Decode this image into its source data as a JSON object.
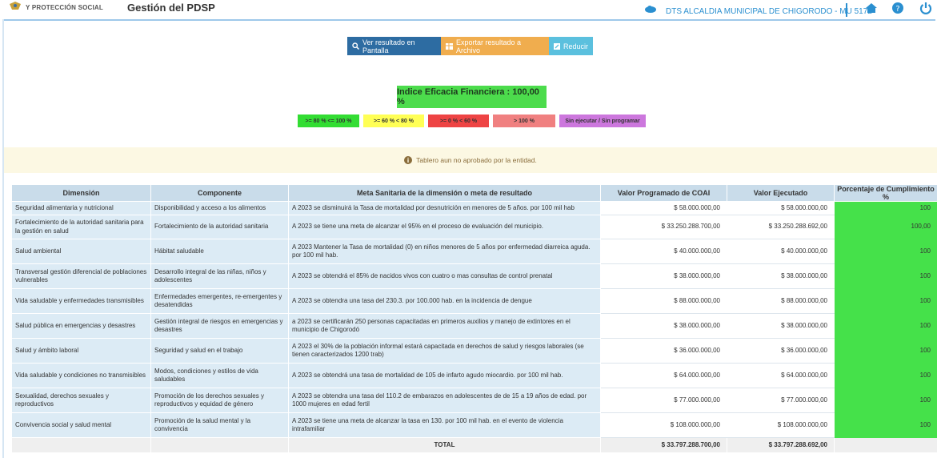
{
  "header": {
    "org_label": "Y PROTECCIÓN SOCIAL",
    "app_title": "Gestión del PDSP",
    "entity": "DTS ALCALDIA MUNICIPAL DE CHIGORODO - MU 5172",
    "icons": [
      "home-icon",
      "help-icon",
      "power-icon"
    ],
    "accent_color": "#2a8fd0"
  },
  "actions": {
    "view_label": "Ver resultado en Pantalla",
    "export_label": "Exportar resultado a Archivo",
    "reduce_label": "Reducir"
  },
  "indicator": {
    "label": "Indice Eficacia Financiera : 100,00 %"
  },
  "legend": [
    {
      "label": ">= 80 % <= 100 %",
      "color": "#33dd33"
    },
    {
      "label": ">= 60 % < 80 %",
      "color": "#ffff55"
    },
    {
      "label": ">= 0 % < 60 %",
      "color": "#ee4444"
    },
    {
      "label": "> 100 %",
      "color": "#f08080"
    },
    {
      "label": "Sin ejecutar / Sin programar",
      "color": "#cc77dd"
    }
  ],
  "notice": "Tablero aun no aprobado por la entidad.",
  "table": {
    "headers": [
      "Dimensión",
      "Componente",
      "Meta Sanitaria de la dimensión o meta de resultado",
      "Valor Programado de COAI",
      "Valor Ejecutado",
      "Porcentaje de Cumplimiento %"
    ],
    "rows": [
      [
        "Seguridad alimentaria y nutricional",
        "Disponibilidad y acceso a los alimentos",
        "A 2023 se disminuirá la Tasa de mortalidad por desnutrición en menores de 5 años. por 100 mil hab",
        "$ 58.000.000,00",
        "$ 58.000.000,00",
        "100"
      ],
      [
        "Fortalecimiento de la autoridad sanitaria para la gestión en salud",
        "Fortalecimiento de la autoridad sanitaria",
        "A 2023 se tiene una meta de alcanzar el 95% en el proceso de evaluación del municipio.",
        "$ 33.250.288.700,00",
        "$ 33.250.288.692,00",
        "100,00"
      ],
      [
        "Salud ambiental",
        "Hábitat saludable",
        "A 2023 Mantener la Tasa de mortalidad (0) en niños menores de 5 años por enfermedad diarreica aguda. por 100 mil hab.",
        "$ 40.000.000,00",
        "$ 40.000.000,00",
        "100"
      ],
      [
        "Transversal gestión diferencial de poblaciones vulnerables",
        "Desarrollo integral de las niñas, niños y adolescentes",
        "A 2023 se obtendrá el 85% de nacidos vivos con cuatro o mas consultas de control prenatal",
        "$ 38.000.000,00",
        "$ 38.000.000,00",
        "100"
      ],
      [
        "Vida saludable y enfermedades transmisibles",
        "Enfermedades emergentes, re-emergentes y desatendidas",
        "A 2023 se obtendra una tasa del 230.3. por 100.000 hab. en la incidencia de dengue",
        "$ 88.000.000,00",
        "$ 88.000.000,00",
        "100"
      ],
      [
        "Salud pública en emergencias y desastres",
        "Gestión integral de riesgos en emergencias y desastres",
        "a 2023 se certificarán 250 personas capacitadas en primeros auxilios y manejo de extintores en el municipio de Chigorodó",
        "$ 38.000.000,00",
        "$ 38.000.000,00",
        "100"
      ],
      [
        "Salud y ámbito laboral",
        "Seguridad y salud en el trabajo",
        "A 2023 el 30% de la población informal estará capacitada en derechos de salud y riesgos laborales (se tienen caracterizados 1200 trab)",
        "$ 36.000.000,00",
        "$ 36.000.000,00",
        "100"
      ],
      [
        "Vida saludable y condiciones no transmisibles",
        "Modos, condiciones y estilos de vida saludables",
        "A 2023 se obtendrá una tasa de mortalidad de 105 de infarto agudo miocardio. por 100 mil hab.",
        "$ 64.000.000,00",
        "$ 64.000.000,00",
        "100"
      ],
      [
        "Sexualidad, derechos sexuales y reproductivos",
        "Promoción de los derechos sexuales y reproductivos y equidad de género",
        "A 2023 se obtendra una tasa del 110.2 de embarazos en adolescentes de de 15 a 19 años de edad. por 1000 mujeres en edad fertil",
        "$ 77.000.000,00",
        "$ 77.000.000,00",
        "100"
      ],
      [
        "Convivencia social y salud mental",
        "Promoción de la salud mental y la convivencia",
        "A 2023 se tiene una meta de alcanzar la tasa en 130. por 100 mil hab. en el evento de violencia intrafamiliar",
        "$ 108.000.000,00",
        "$ 108.000.000,00",
        "100"
      ]
    ],
    "total_label": "TOTAL",
    "total_programado": "$ 33.797.288.700,00",
    "total_ejecutado": "$ 33.797.288.692,00",
    "compliance_color": "#45e14a"
  }
}
